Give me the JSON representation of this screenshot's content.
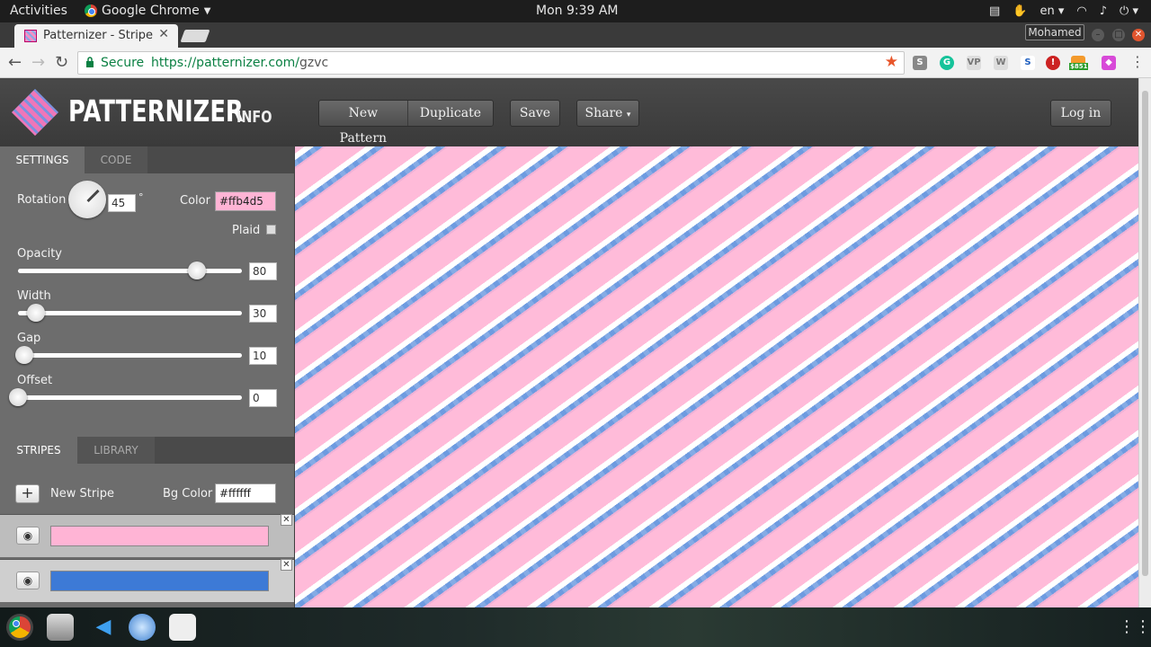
{
  "system_bar": {
    "activities": "Activities",
    "app_name": "Google Chrome",
    "clock": "Mon  9:39 AM",
    "language": "en"
  },
  "browser": {
    "tab_title": "Patternizer - Stripe",
    "profile_name": "Mohamed",
    "secure_label": "Secure",
    "url_host": "https://patternizer.com/",
    "url_path": "gzvc",
    "ext_badge": "$851"
  },
  "header": {
    "logo_text": "PATTERNIZER",
    "info_label": "INFO",
    "new_pattern": "New Pattern",
    "duplicate": "Duplicate",
    "save": "Save",
    "share": "Share",
    "login": "Log in"
  },
  "settings": {
    "tabs": [
      "SETTINGS",
      "CODE"
    ],
    "rotation_label": "Rotation",
    "rotation_value": "45",
    "degree_symbol": "°",
    "color_label": "Color",
    "color_value": "#ffb4d5",
    "plaid_label": "Plaid",
    "sliders": [
      {
        "label": "Opacity",
        "value": "80",
        "fraction": 0.8
      },
      {
        "label": "Width",
        "value": "30",
        "fraction": 0.08
      },
      {
        "label": "Gap",
        "value": "10",
        "fraction": 0.03
      },
      {
        "label": "Offset",
        "value": "0",
        "fraction": 0.0
      }
    ]
  },
  "stripes_panel": {
    "tabs": [
      "STRIPES",
      "LIBRARY"
    ],
    "new_stripe_label": "New Stripe",
    "bg_color_label": "Bg Color",
    "bg_color_value": "#ffffff",
    "stripes": [
      {
        "color": "#ffb4d5"
      },
      {
        "color": "#3d7ad6"
      }
    ]
  },
  "colors": {
    "stripe_pink": "#ffb4d5",
    "stripe_blue": "#3d7ad6",
    "background": "#ffffff"
  }
}
